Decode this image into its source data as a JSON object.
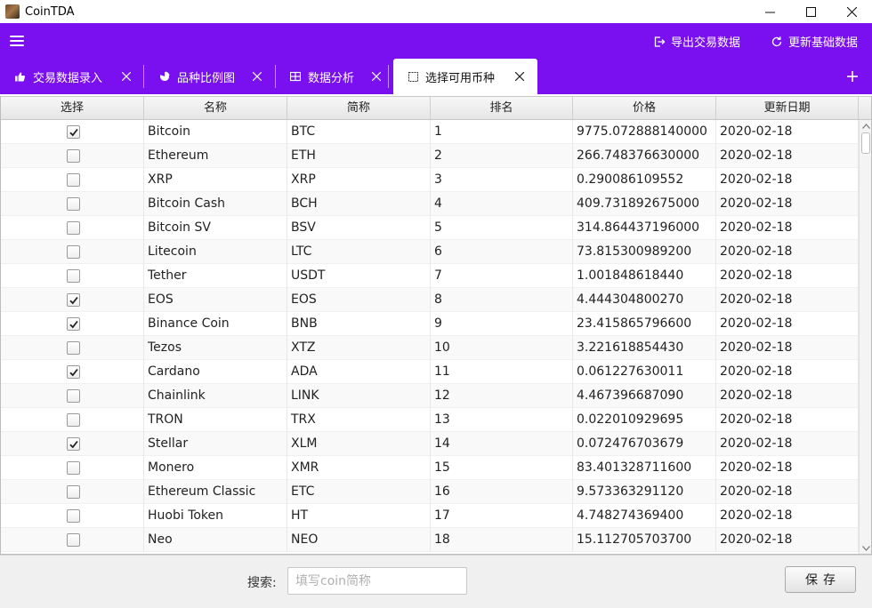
{
  "window": {
    "title": "CoinTDA",
    "minimize_glyph": "—",
    "maximize_glyph": "☐",
    "close_glyph": "✕"
  },
  "header": {
    "bg_color": "#7a0ff0",
    "menu_icon": "hamburger-icon",
    "actions": [
      {
        "label": "导出交易数据",
        "icon": "export-icon"
      },
      {
        "label": "更新基础数据",
        "icon": "refresh-icon"
      }
    ]
  },
  "tabs": [
    {
      "label": "交易数据录入",
      "icon": "thumbs-up-icon",
      "active": false
    },
    {
      "label": "品种比例图",
      "icon": "pie-chart-icon",
      "active": false
    },
    {
      "label": "数据分析",
      "icon": "table-icon",
      "active": false
    },
    {
      "label": "选择可用币种",
      "icon": "checkbox-icon",
      "active": true
    }
  ],
  "table": {
    "columns": [
      "选择",
      "名称",
      "简称",
      "排名",
      "价格",
      "更新日期"
    ],
    "rows": [
      {
        "checked": true,
        "name": "Bitcoin",
        "symbol": "BTC",
        "rank": "1",
        "price": "9775.072888140000",
        "date": "2020-02-18"
      },
      {
        "checked": false,
        "name": "Ethereum",
        "symbol": "ETH",
        "rank": "2",
        "price": "266.748376630000",
        "date": "2020-02-18"
      },
      {
        "checked": false,
        "name": "XRP",
        "symbol": "XRP",
        "rank": "3",
        "price": "0.290086109552",
        "date": "2020-02-18"
      },
      {
        "checked": false,
        "name": "Bitcoin Cash",
        "symbol": "BCH",
        "rank": "4",
        "price": "409.731892675000",
        "date": "2020-02-18"
      },
      {
        "checked": false,
        "name": "Bitcoin SV",
        "symbol": "BSV",
        "rank": "5",
        "price": "314.864437196000",
        "date": "2020-02-18"
      },
      {
        "checked": false,
        "name": "Litecoin",
        "symbol": "LTC",
        "rank": "6",
        "price": "73.815300989200",
        "date": "2020-02-18"
      },
      {
        "checked": false,
        "name": "Tether",
        "symbol": "USDT",
        "rank": "7",
        "price": "1.001848618440",
        "date": "2020-02-18"
      },
      {
        "checked": true,
        "name": "EOS",
        "symbol": "EOS",
        "rank": "8",
        "price": "4.444304800270",
        "date": "2020-02-18"
      },
      {
        "checked": true,
        "name": "Binance Coin",
        "symbol": "BNB",
        "rank": "9",
        "price": "23.415865796600",
        "date": "2020-02-18"
      },
      {
        "checked": false,
        "name": "Tezos",
        "symbol": "XTZ",
        "rank": "10",
        "price": "3.221618854430",
        "date": "2020-02-18"
      },
      {
        "checked": true,
        "name": "Cardano",
        "symbol": "ADA",
        "rank": "11",
        "price": "0.061227630011",
        "date": "2020-02-18"
      },
      {
        "checked": false,
        "name": "Chainlink",
        "symbol": "LINK",
        "rank": "12",
        "price": "4.467396687090",
        "date": "2020-02-18"
      },
      {
        "checked": false,
        "name": "TRON",
        "symbol": "TRX",
        "rank": "13",
        "price": "0.022010929695",
        "date": "2020-02-18"
      },
      {
        "checked": true,
        "name": "Stellar",
        "symbol": "XLM",
        "rank": "14",
        "price": "0.072476703679",
        "date": "2020-02-18"
      },
      {
        "checked": false,
        "name": "Monero",
        "symbol": "XMR",
        "rank": "15",
        "price": "83.401328711600",
        "date": "2020-02-18"
      },
      {
        "checked": false,
        "name": "Ethereum Classic",
        "symbol": "ETC",
        "rank": "16",
        "price": "9.573363291120",
        "date": "2020-02-18"
      },
      {
        "checked": false,
        "name": "Huobi Token",
        "symbol": "HT",
        "rank": "17",
        "price": "4.748274369400",
        "date": "2020-02-18"
      },
      {
        "checked": false,
        "name": "Neo",
        "symbol": "NEO",
        "rank": "18",
        "price": "15.112705703700",
        "date": "2020-02-18"
      }
    ]
  },
  "footer": {
    "search_label": "搜索:",
    "search_placeholder": "填写coin简称",
    "search_value": "",
    "save_label": "保存"
  }
}
